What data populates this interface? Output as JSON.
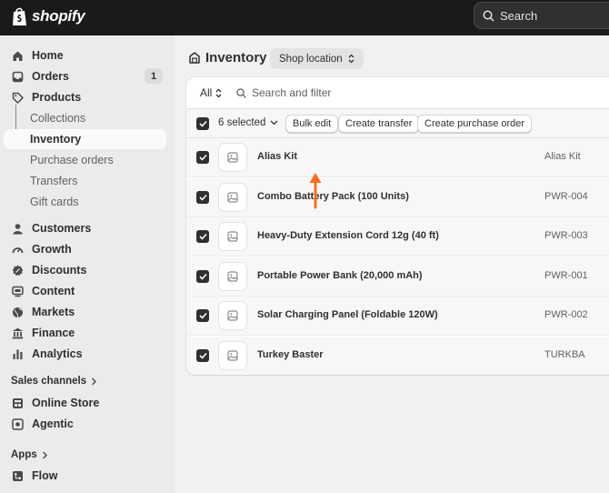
{
  "topbar": {
    "brand": "shopify",
    "search_label": "Search"
  },
  "sidebar": {
    "items": [
      {
        "label": "Home",
        "icon": "home-icon"
      },
      {
        "label": "Orders",
        "icon": "inbox-icon",
        "badge": "1"
      },
      {
        "label": "Products",
        "icon": "tag-icon"
      },
      {
        "label": "Customers",
        "icon": "person-icon"
      },
      {
        "label": "Growth",
        "icon": "gauge-icon"
      },
      {
        "label": "Discounts",
        "icon": "discount-icon"
      },
      {
        "label": "Content",
        "icon": "content-icon"
      },
      {
        "label": "Markets",
        "icon": "globe-icon"
      },
      {
        "label": "Finance",
        "icon": "bank-icon"
      },
      {
        "label": "Analytics",
        "icon": "bar-chart-icon"
      }
    ],
    "product_subitems": [
      "Collections",
      "Inventory",
      "Purchase orders",
      "Transfers",
      "Gift cards"
    ],
    "sales_channels": {
      "heading": "Sales channels",
      "items": [
        {
          "label": "Online Store",
          "icon": "store-icon"
        },
        {
          "label": "Agentic",
          "icon": "agentic-icon"
        }
      ]
    },
    "apps": {
      "heading": "Apps",
      "items": [
        {
          "label": "Flow",
          "icon": "flow-icon"
        }
      ]
    }
  },
  "main": {
    "title": "Inventory",
    "location_button": "Shop location",
    "filter": {
      "tab_all": "All",
      "search_placeholder": "Search and filter"
    },
    "bulk": {
      "selected_label": "6 selected",
      "bulk_edit": "Bulk edit",
      "create_transfer": "Create transfer",
      "create_purchase_order": "Create purchase order"
    },
    "products": [
      {
        "name": "Alias Kit",
        "sku": "Alias Kit",
        "checked": true
      },
      {
        "name": "Combo Battery Pack (100 Units)",
        "sku": "PWR-004",
        "checked": true
      },
      {
        "name": "Heavy-Duty Extension Cord 12g (40 ft)",
        "sku": "PWR-003",
        "checked": true
      },
      {
        "name": "Portable Power Bank (20,000 mAh)",
        "sku": "PWR-001",
        "checked": true
      },
      {
        "name": "Solar Charging Panel (Foldable 120W)",
        "sku": "PWR-002",
        "checked": true
      },
      {
        "name": "Turkey Baster",
        "sku": "TURKBA",
        "checked": true
      }
    ]
  },
  "colors": {
    "topbar": "#1a1a1a",
    "sidebar": "#ebebeb",
    "accent_arrow": "#ff6b1a",
    "checkbox": "#303030"
  }
}
